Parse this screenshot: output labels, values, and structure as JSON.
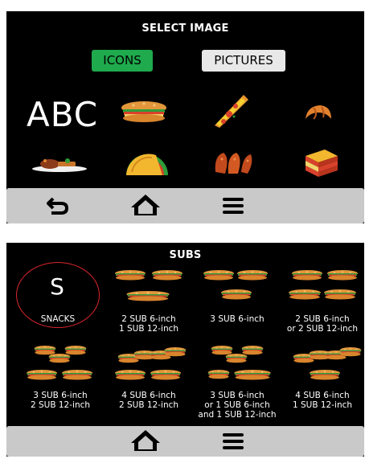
{
  "screen1": {
    "title": "SELECT IMAGE",
    "tab_icons_label": "ICONS",
    "tab_pictures_label": "PICTURES",
    "abc_text": "ABC",
    "icons": [
      "sandwich-icon",
      "pizza-slice-icon",
      "croissant-icon",
      "plated-meal-icon",
      "taco-icon",
      "chicken-wings-icon",
      "lasagna-icon"
    ],
    "colors": {
      "active_tab": "#1faa4d",
      "inactive_tab": "#e8e8e8",
      "bar": "#c9c9c9"
    }
  },
  "screen2": {
    "title": "SUBS",
    "cells": [
      {
        "letter": "S",
        "label": "SNACKS"
      },
      {
        "label": "2 SUB 6-inch\n1 SUB 12-inch"
      },
      {
        "label": "3 SUB 6-inch"
      },
      {
        "label": "2 SUB 6-inch\nor 2 SUB 12-inch"
      },
      {
        "label": "3 SUB 6-inch\n2 SUB 12-inch"
      },
      {
        "label": "4 SUB 6-inch\n2 SUB 12-inch"
      },
      {
        "label": "3 SUB 6-inch\nor 1 SUB 6-inch\nand 1 SUB 12-inch"
      },
      {
        "label": "4 SUB 6-inch\n1 SUB 12-inch"
      }
    ]
  },
  "nav": {
    "back": "back-icon",
    "home": "home-icon",
    "menu": "menu-icon"
  }
}
